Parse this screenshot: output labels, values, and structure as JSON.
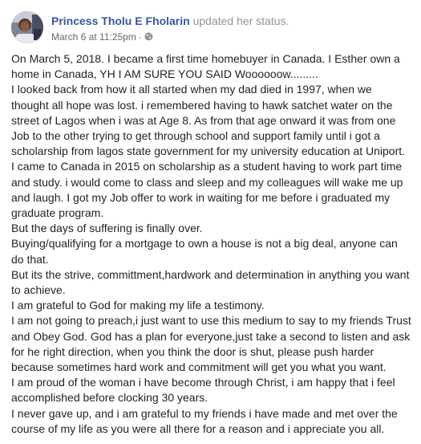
{
  "post": {
    "author_name": "Princess Tholu E Fholarin",
    "action": "updated her status.",
    "timestamp": "March 6 at 11:25pm",
    "separator": "·",
    "privacy_icon": "globe-icon",
    "avatar_icon": "profile-photo",
    "paragraphs": [
      "On March 5, 2018. I became a first time homebuyer in Canada. I Esther own a home in Canada, YH I AM SURE YOU SAID Woooooow.........",
      "I looked back from how it all started when my dad died in 1997, when we thought all hope was lost. i remembered having to hawk satchet water on the street of Lagos when i was at Age 8. As from that age onward it was from one Job to the other trying to get through school and support family until i got a scholarship from lagos state government for my university education at Uniport.",
      "I came to Canada in 2015 on scholarship as a student having to work part time and study. i would come to class and sleep and my colleagues will wake me up and laugh. I got my Job offer to work in waiting for me before i graduated my graduate program.",
      "But the days of suffering is finally over.",
      "Buying/qualifying for a mortgage to own a house is not a big deal, anyone can do that.",
      "But its the strive, committment,hardwork and determination in anything you want to achieve.",
      "I am grateful to God for making my life a testimony.",
      "I am not going to preach,i just want to use this medium to say to my friends Trust and Obey God. God has a plan for everyone,just take a second to listen and ask for he right direction, when you think the door is shut, please push harder because sometimes hard work and commitment will get you what you want.",
      "I am proud of the woman i have become through Christ, i am happy that i feel accomplished before clocking 30 years.",
      "I never gave up, and i am grateful to my friends i have made and met over the course of my life as you were all there for a reason and i appreciate you all."
    ]
  }
}
